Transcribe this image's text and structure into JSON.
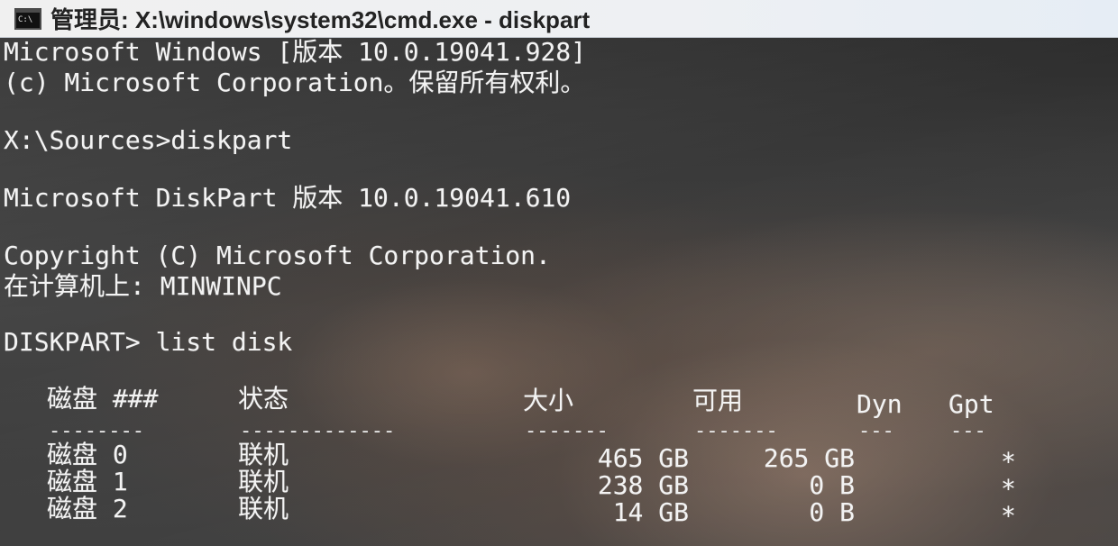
{
  "window": {
    "icon_label": "C:\\",
    "title": "管理员: X:\\windows\\system32\\cmd.exe - diskpart"
  },
  "terminal": {
    "lines": [
      "Microsoft Windows [版本 10.0.19041.928]",
      "(c) Microsoft Corporation。保留所有权利。",
      "X:\\Sources>diskpart",
      "Microsoft DiskPart 版本 10.0.19041.610",
      "Copyright (C) Microsoft Corporation.",
      "在计算机上: MINWINPC",
      "DISKPART> list disk"
    ],
    "table": {
      "headers": [
        "磁盘 ###",
        "状态",
        "大小",
        "可用",
        "Dyn",
        "Gpt"
      ],
      "separators": [
        "--------",
        "-------------",
        "-------",
        "-------",
        "---",
        "---"
      ],
      "rows": [
        {
          "disk": "磁盘 0",
          "status": "联机",
          "size": "465 GB",
          "free": "265 GB",
          "dyn": "",
          "gpt": "*"
        },
        {
          "disk": "磁盘 1",
          "status": "联机",
          "size": "238 GB",
          "free": "0 B",
          "dyn": "",
          "gpt": "*"
        },
        {
          "disk": "磁盘 2",
          "status": "联机",
          "size": "14 GB",
          "free": "0 B",
          "dyn": "",
          "gpt": "*"
        }
      ]
    }
  }
}
